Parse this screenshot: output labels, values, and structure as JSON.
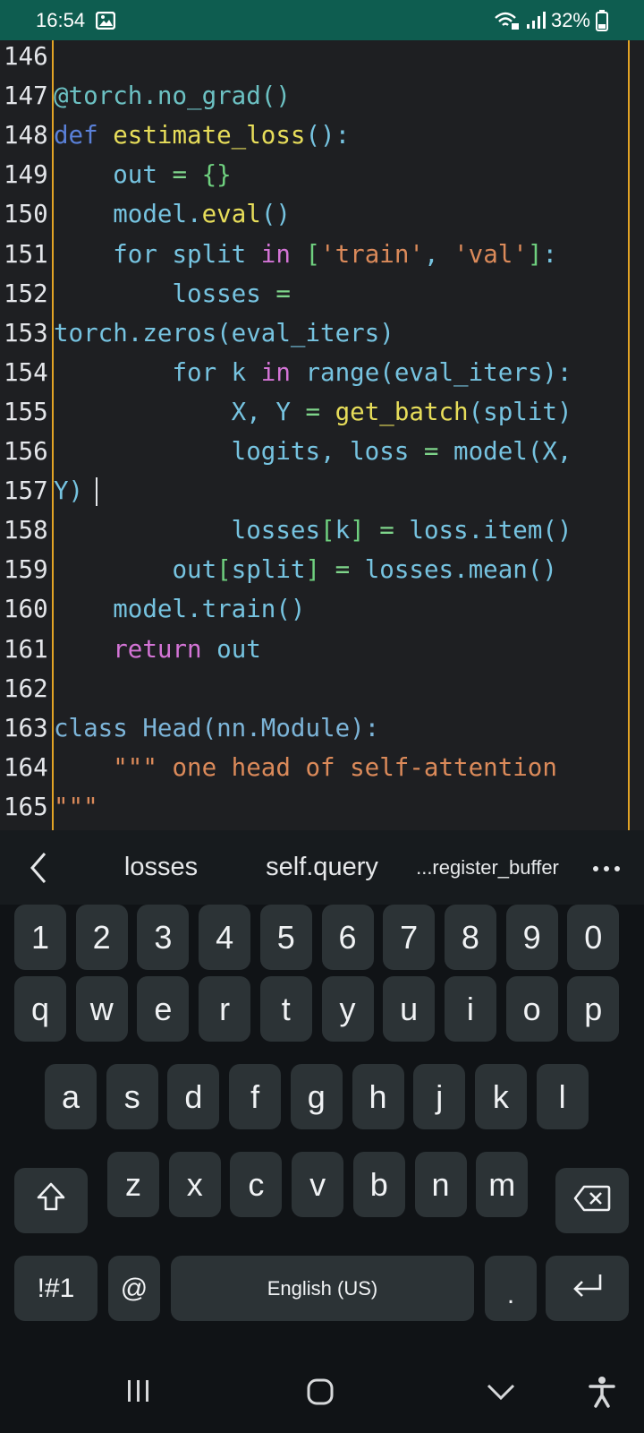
{
  "status_bar": {
    "time": "16:54",
    "battery_percent": "32%",
    "icons": [
      "gallery-icon",
      "wifi-calling-icon",
      "signal-icon",
      "battery-icon"
    ]
  },
  "editor": {
    "accent_color": "#e3a325",
    "lines": [
      {
        "n": "146",
        "tokens": []
      },
      {
        "n": "147",
        "tokens": [
          [
            "dec",
            "@torch.no_grad()"
          ]
        ]
      },
      {
        "n": "148",
        "tokens": [
          [
            "kw",
            "def"
          ],
          [
            "id",
            " "
          ],
          [
            "fn",
            "estimate_loss"
          ],
          [
            "id",
            "():"
          ]
        ]
      },
      {
        "n": "149",
        "tokens": [
          [
            "id",
            "    out "
          ],
          [
            "op",
            "="
          ],
          [
            "id",
            " "
          ],
          [
            "br",
            "{}"
          ]
        ]
      },
      {
        "n": "150",
        "tokens": [
          [
            "id",
            "    model."
          ],
          [
            "fn",
            "eval"
          ],
          [
            "id",
            "()"
          ]
        ]
      },
      {
        "n": "151",
        "tokens": [
          [
            "id",
            "    for split "
          ],
          [
            "in",
            "in"
          ],
          [
            "id",
            " "
          ],
          [
            "br",
            "["
          ],
          [
            "str",
            "'train'"
          ],
          [
            "id",
            ", "
          ],
          [
            "str",
            "'val'"
          ],
          [
            "br",
            "]"
          ],
          [
            "id",
            ":"
          ]
        ]
      },
      {
        "n": "152",
        "tokens": [
          [
            "id",
            "        losses "
          ],
          [
            "op",
            "="
          ]
        ]
      },
      {
        "n": "153",
        "tokens": [
          [
            "id",
            "torch.zeros(eval_iters)"
          ]
        ]
      },
      {
        "n": "154",
        "tokens": [
          [
            "id",
            "        for k "
          ],
          [
            "in",
            "in"
          ],
          [
            "id",
            " range(eval_iters):"
          ]
        ]
      },
      {
        "n": "155",
        "tokens": [
          [
            "id",
            "            X, Y "
          ],
          [
            "op",
            "="
          ],
          [
            "id",
            " "
          ],
          [
            "fn",
            "get_batch"
          ],
          [
            "id",
            "(split)"
          ]
        ]
      },
      {
        "n": "156",
        "tokens": [
          [
            "id",
            "            logits, loss "
          ],
          [
            "op",
            "="
          ],
          [
            "id",
            " model(X,"
          ]
        ]
      },
      {
        "n": "157",
        "tokens": [
          [
            "id",
            "Y)"
          ]
        ],
        "cursor": true
      },
      {
        "n": "158",
        "tokens": [
          [
            "id",
            "            losses"
          ],
          [
            "br",
            "["
          ],
          [
            "id",
            "k"
          ],
          [
            "br",
            "]"
          ],
          [
            "id",
            " "
          ],
          [
            "op",
            "="
          ],
          [
            "id",
            " loss.item()"
          ]
        ]
      },
      {
        "n": "159",
        "tokens": [
          [
            "id",
            "        out"
          ],
          [
            "br",
            "["
          ],
          [
            "id",
            "split"
          ],
          [
            "br",
            "]"
          ],
          [
            "id",
            " "
          ],
          [
            "op",
            "="
          ],
          [
            "id",
            " losses.mean()"
          ]
        ]
      },
      {
        "n": "160",
        "tokens": [
          [
            "id",
            "    model.train()"
          ]
        ]
      },
      {
        "n": "161",
        "tokens": [
          [
            "ret",
            "    return"
          ],
          [
            "id",
            " out"
          ]
        ]
      },
      {
        "n": "162",
        "tokens": []
      },
      {
        "n": "163",
        "tokens": [
          [
            "cls",
            "class Head(nn.Module):"
          ]
        ]
      },
      {
        "n": "164",
        "tokens": [
          [
            "str",
            "    \"\"\" one head of self-attention"
          ]
        ]
      },
      {
        "n": "165",
        "tokens": [
          [
            "str",
            "\"\"\""
          ]
        ]
      }
    ]
  },
  "suggestions": {
    "items": [
      "losses",
      "self.query",
      "...register_buffer"
    ]
  },
  "keyboard": {
    "row_numbers": [
      "1",
      "2",
      "3",
      "4",
      "5",
      "6",
      "7",
      "8",
      "9",
      "0"
    ],
    "row1": [
      "q",
      "w",
      "e",
      "r",
      "t",
      "y",
      "u",
      "i",
      "o",
      "p"
    ],
    "row2": [
      "a",
      "s",
      "d",
      "f",
      "g",
      "h",
      "j",
      "k",
      "l"
    ],
    "row3": [
      "z",
      "x",
      "c",
      "v",
      "b",
      "n",
      "m"
    ],
    "symbols_label": "!#1",
    "at_label": "@",
    "space_label": "English (US)",
    "period_label": "."
  }
}
